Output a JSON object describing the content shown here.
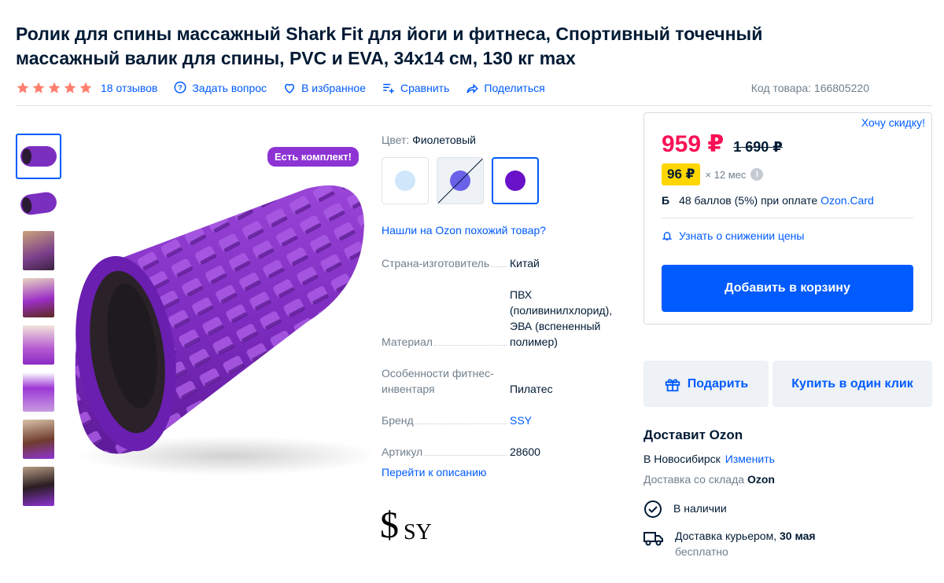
{
  "product": {
    "title": "Ролик для спины массажный Shark Fit для йоги и фитнеса, Спортивный точечный массажный валик для спины, PVC и EVA, 34x14 см, 130 кг max"
  },
  "meta": {
    "rating_stars": 5,
    "reviews": "18 отзывов",
    "ask": "Задать вопрос",
    "favorite": "В избранное",
    "compare": "Сравнить",
    "share": "Поделиться",
    "sku": "Код товара: 166805220"
  },
  "gallery": {
    "badge": "Есть комплект!"
  },
  "color": {
    "label": "Цвет:",
    "value": "Фиолетовый",
    "swatches": [
      {
        "name": "light-blue",
        "color": "#cfe6fb"
      },
      {
        "name": "blue-violet",
        "color": "#6a61e8"
      },
      {
        "name": "purple",
        "color": "#6a12c9"
      }
    ]
  },
  "similar_link": "Нашли на Ozon похожий товар?",
  "specs": [
    {
      "k": "Страна-изготовитель",
      "v": "Китай"
    },
    {
      "k": "Материал",
      "v": "ПВХ (поливинилхлорид), ЭВА (вспененный полимер)"
    },
    {
      "k": "Особенности фитнес-инвентаря",
      "v": "Пилатес"
    },
    {
      "k": "Бренд",
      "v": "SSY"
    },
    {
      "k": "Артикул",
      "v": "28600"
    }
  ],
  "desc_link": "Перейти к описанию",
  "brand_logo_text": "SSY",
  "price": {
    "want_discount": "Хочу скидку!",
    "current": "959 ₽",
    "old": "1 690 ₽",
    "installment": "96 ₽",
    "installment_term": "× 12 мес",
    "points_icon": "Б",
    "points_text": "48 баллов (5%) при оплате",
    "points_link": "Ozon.Card",
    "notify": "Узнать о снижении цены",
    "cart": "Добавить в корзину"
  },
  "actions": {
    "gift": "Подарить",
    "buy_one_click": "Купить в один клик"
  },
  "delivery": {
    "heading": "Доставит Ozon",
    "city": "В Новосибирск",
    "change": "Изменить",
    "warehouse_prefix": "Доставка со склада",
    "warehouse": "Ozon",
    "in_stock": "В наличии",
    "courier": "Доставка курьером,",
    "date": "30 мая",
    "cost": "бесплатно"
  },
  "colors": {
    "accent": "#005bff",
    "price": "#f91155",
    "badge": "#8d33d4",
    "installment": "#ffd600",
    "star": "#ff7f6e"
  }
}
